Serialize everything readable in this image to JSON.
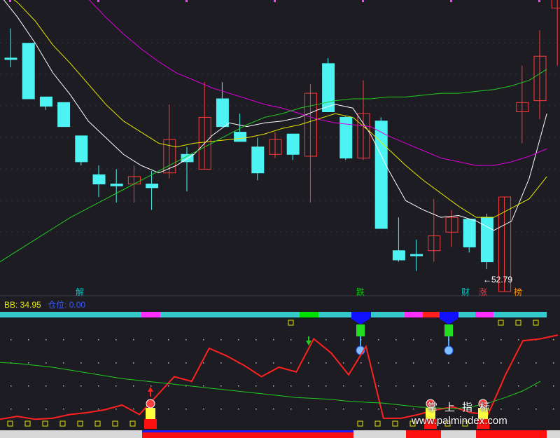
{
  "indicator": {
    "bb_label": "BB: 34.95",
    "position_label": "仓位: 0.00"
  },
  "annotations": {
    "price_note": "←52.79",
    "markers": [
      {
        "text": "解",
        "color": "#00c8c8"
      },
      {
        "text": "跌",
        "color": "#00d000"
      },
      {
        "text": "财",
        "color": "#00c8c8"
      },
      {
        "text": "涨",
        "color": "#ff3030"
      },
      {
        "text": "榜",
        "color": "#ff8c00"
      }
    ]
  },
  "watermark": {
    "cn": "掌上指标",
    "url": "www.palmindex.com"
  },
  "colors": {
    "background": "#1c1c22",
    "up": "#ff3b3b",
    "down": "#4df2f2",
    "ma_white": "#ffffff",
    "ma_yellow": "#e8e800",
    "ma_magenta": "#e000e0",
    "ma_green": "#22cc22",
    "osc_red": "#ff2020",
    "osc_green": "#22cc22"
  },
  "chart_data": [
    {
      "type": "candlestick",
      "title": "",
      "xlabel": "",
      "ylabel": "",
      "grid": true,
      "x": [
        0,
        1,
        2,
        3,
        4,
        5,
        6,
        7,
        8,
        9,
        10,
        11,
        12,
        13,
        14,
        15,
        16,
        17,
        18,
        19,
        20,
        21,
        22,
        23,
        24,
        25,
        26,
        27,
        28,
        29,
        30
      ],
      "ylim": [
        20,
        160
      ],
      "candles": [
        {
          "o": 140,
          "c": 140,
          "h": 156,
          "l": 135,
          "up": false
        },
        {
          "o": 148,
          "c": 118,
          "h": 148,
          "l": 118,
          "up": false
        },
        {
          "o": 119,
          "c": 114,
          "h": 119,
          "l": 112,
          "up": false
        },
        {
          "o": 116,
          "c": 103,
          "h": 116,
          "l": 103,
          "up": false
        },
        {
          "o": 98,
          "c": 84,
          "h": 98,
          "l": 82,
          "up": false
        },
        {
          "o": 77,
          "c": 72,
          "h": 82,
          "l": 65,
          "up": false
        },
        {
          "o": 72,
          "c": 71,
          "h": 80,
          "l": 62,
          "up": false
        },
        {
          "o": 72,
          "c": 76,
          "h": 82,
          "l": 62,
          "up": true
        },
        {
          "o": 72,
          "c": 70,
          "h": 79,
          "l": 58,
          "up": false
        },
        {
          "o": 78,
          "c": 96,
          "h": 115,
          "l": 75,
          "up": true
        },
        {
          "o": 88,
          "c": 84,
          "h": 92,
          "l": 68,
          "up": false
        },
        {
          "o": 80,
          "c": 108,
          "h": 127,
          "l": 80,
          "up": true
        },
        {
          "o": 118,
          "c": 103,
          "h": 127,
          "l": 103,
          "up": false
        },
        {
          "o": 100,
          "c": 95,
          "h": 110,
          "l": 95,
          "up": false
        },
        {
          "o": 92,
          "c": 78,
          "h": 97,
          "l": 74,
          "up": false
        },
        {
          "o": 88,
          "c": 96,
          "h": 100,
          "l": 86,
          "up": true
        },
        {
          "o": 99,
          "c": 88,
          "h": 99,
          "l": 85,
          "up": false
        },
        {
          "o": 87,
          "c": 121,
          "h": 126,
          "l": 62,
          "up": true
        },
        {
          "o": 137,
          "c": 111,
          "h": 140,
          "l": 111,
          "up": false
        },
        {
          "o": 108,
          "c": 86,
          "h": 109,
          "l": 85,
          "up": false
        },
        {
          "o": 86,
          "c": 110,
          "h": 128,
          "l": 85,
          "up": true
        },
        {
          "o": 106,
          "c": 48,
          "h": 108,
          "l": 48,
          "up": false
        },
        {
          "o": 36,
          "c": 31,
          "h": 54,
          "l": 30,
          "up": false
        },
        {
          "o": 34,
          "c": 34,
          "h": 42,
          "l": 25,
          "up": false
        },
        {
          "o": 36,
          "c": 44,
          "h": 64,
          "l": 30,
          "up": true
        },
        {
          "o": 46,
          "c": 54,
          "h": 58,
          "l": 38,
          "up": true
        },
        {
          "o": 53,
          "c": 38,
          "h": 53,
          "l": 35,
          "up": false
        },
        {
          "o": 54,
          "c": 30,
          "h": 56,
          "l": 26,
          "up": false
        },
        {
          "o": 14,
          "c": 65,
          "h": 65,
          "l": 14,
          "up": true
        },
        {
          "o": 111,
          "c": 116,
          "h": 136,
          "l": 94,
          "up": true
        },
        {
          "o": 117,
          "c": 141,
          "h": 155,
          "l": 107,
          "up": true
        }
      ],
      "extra_candle": {
        "x": 31,
        "o": 167,
        "c": 215,
        "h": 240,
        "l": 136,
        "up": true
      },
      "series": [
        {
          "name": "",
          "color": "ma_white",
          "values": [
            174,
            162,
            148,
            132,
            120,
            106,
            97,
            88,
            82,
            78,
            82,
            88,
            98,
            105,
            103,
            105,
            106,
            108,
            112,
            115,
            113,
            99,
            80,
            63,
            58,
            54,
            55,
            52,
            47,
            52,
            75,
            110
          ]
        },
        {
          "name": "",
          "color": "ma_yellow",
          "values": [
            177,
            170,
            160,
            147,
            137,
            126,
            115,
            106,
            100,
            94,
            92,
            94,
            95,
            96,
            97,
            99,
            102,
            104,
            107,
            110,
            108,
            100,
            91,
            82,
            74,
            67,
            60,
            54,
            54,
            59,
            64,
            76
          ]
        },
        {
          "name": "",
          "color": "ma_magenta",
          "values": [
            214,
            208,
            200,
            190,
            180,
            172,
            162,
            153,
            145,
            138,
            132,
            128,
            124,
            121,
            118,
            115,
            113,
            110,
            107,
            105,
            104,
            103,
            98,
            94,
            90,
            86,
            84,
            82,
            82,
            84,
            87,
            91
          ]
        },
        {
          "name": "",
          "color": "ma_green",
          "values": [
            30,
            36,
            42,
            48,
            54,
            59,
            64,
            69,
            74,
            79,
            84,
            89,
            94,
            99,
            104,
            108,
            110,
            113,
            115,
            117,
            118,
            118,
            119,
            119,
            120,
            121,
            121,
            122,
            123,
            125,
            128,
            134
          ]
        }
      ]
    },
    {
      "type": "line",
      "title": "",
      "xlabel": "",
      "ylabel": "",
      "ylim": [
        0,
        100
      ],
      "series": [
        {
          "name": "",
          "color": "osc_red",
          "values": [
            5,
            8,
            5,
            6,
            10,
            12,
            15,
            20,
            10,
            30,
            50,
            45,
            80,
            72,
            62,
            50,
            60,
            55,
            90,
            75,
            52,
            82,
            6,
            6,
            10,
            15,
            18,
            12,
            10,
            52,
            88,
            90,
            94
          ]
        },
        {
          "name": "",
          "color": "osc_green",
          "values": [
            65,
            64,
            62,
            60,
            57,
            54,
            51,
            48,
            46,
            44,
            42,
            40,
            38,
            36,
            34,
            32,
            30,
            28,
            27,
            26,
            24,
            23,
            22,
            20,
            18,
            17,
            16,
            18,
            22,
            28,
            35,
            45
          ]
        }
      ]
    }
  ]
}
